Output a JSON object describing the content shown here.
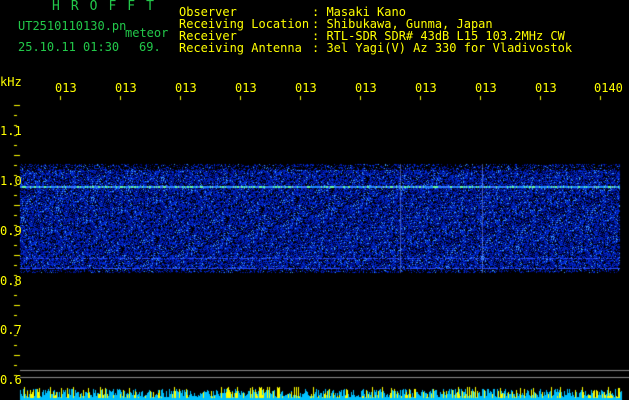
{
  "header": {
    "brand": "HROFFT",
    "filename": "UT2510110130.pn",
    "mode": "meteor",
    "datetime": "25.10.11 01:30",
    "count": "69."
  },
  "station": {
    "rows": [
      {
        "label": "Observer",
        "value": ": Masaki Kano"
      },
      {
        "label": "Receiving Location",
        "value": ": Shibukawa, Gunma, Japan"
      },
      {
        "label": "Receiver",
        "value": ": RTL-SDR SDR# 43dB L15 103.2MHz CW"
      },
      {
        "label": "Receiving Antenna",
        "value": ": 3el Yagi(V) Az 330 for Vladivostok"
      }
    ]
  },
  "axis": {
    "unit": "kHz",
    "time_labels": [
      "013",
      "013",
      "013",
      "013",
      "013",
      "013",
      "013",
      "013",
      "013",
      "0140"
    ],
    "freq_labels": [
      "1.1",
      "1.0",
      "0.9",
      "0.8",
      "0.7",
      "0.6"
    ]
  },
  "colors": {
    "text_green": "#22c84a",
    "text_yellow": "#ffff00",
    "signal_line": "#66ff99",
    "bar_yellow": "#ffff00",
    "bar_cyan": "#00c0ff"
  }
}
